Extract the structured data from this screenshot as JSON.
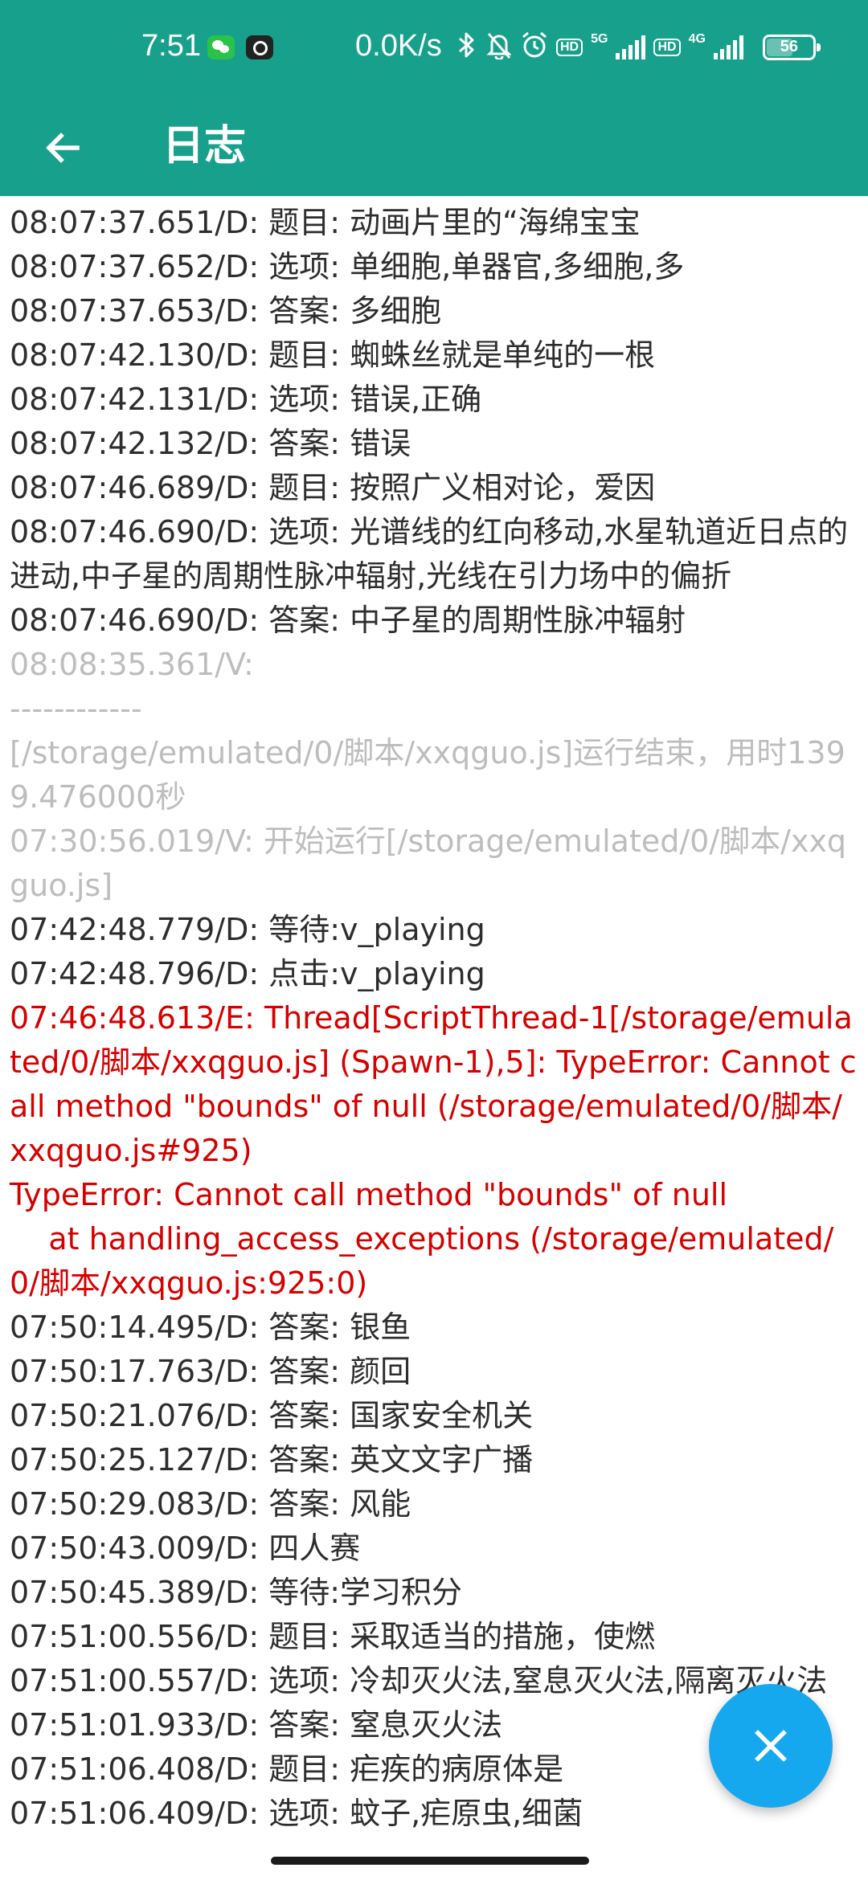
{
  "status_bar": {
    "time": "7:51",
    "net_speed": "0.0K/s",
    "network_1": "5G",
    "network_2": "4G",
    "hd_label": "HD",
    "battery": "56",
    "icons": [
      "wechat-icon",
      "app-notification-icon",
      "bluetooth-icon",
      "mute-bell-icon",
      "alarm-icon",
      "signal-icon",
      "battery-icon"
    ]
  },
  "app_bar": {
    "title": "日志",
    "back_icon": "arrow-left-icon"
  },
  "log_lines": [
    {
      "level": "D",
      "text": "08:07:37.651/D: 题目: 动画片里的“海绵宝宝"
    },
    {
      "level": "D",
      "text": "08:07:37.652/D: 选项: 单细胞,单器官,多细胞,多"
    },
    {
      "level": "D",
      "text": "08:07:37.653/D: 答案: 多细胞"
    },
    {
      "level": "D",
      "text": "08:07:42.130/D: 题目: 蜘蛛丝就是单纯的一根"
    },
    {
      "level": "D",
      "text": "08:07:42.131/D: 选项: 错误,正确"
    },
    {
      "level": "D",
      "text": "08:07:42.132/D: 答案: 错误"
    },
    {
      "level": "D",
      "text": "08:07:46.689/D: 题目: 按照广义相对论，爱因"
    },
    {
      "level": "D",
      "text": "08:07:46.690/D: 选项: 光谱线的红向移动,水星轨道近日点的进动,中子星的周期性脉冲辐射,光线在引力场中的偏折"
    },
    {
      "level": "D",
      "text": "08:07:46.690/D: 答案: 中子星的周期性脉冲辐射"
    },
    {
      "level": "V",
      "text": "08:08:35.361/V:\n------------\n[/storage/emulated/0/脚本/xxqguo.js]运行结束，用时1399.476000秒"
    },
    {
      "level": "V",
      "text": "07:30:56.019/V: 开始运行[/storage/emulated/0/脚本/xxqguo.js]"
    },
    {
      "level": "D",
      "text": "07:42:48.779/D: 等待:v_playing"
    },
    {
      "level": "D",
      "text": "07:42:48.796/D: 点击:v_playing"
    },
    {
      "level": "E",
      "text": "07:46:48.613/E: Thread[ScriptThread-1[/storage/emulated/0/脚本/xxqguo.js] (Spawn-1),5]: TypeError: Cannot call method \"bounds\" of null (/storage/emulated/0/脚本/xxqguo.js#925)\nTypeError: Cannot call method \"bounds\" of null\n    at handling_access_exceptions (/storage/emulated/0/脚本/xxqguo.js:925:0)\n"
    },
    {
      "level": "D",
      "text": "07:50:14.495/D: 答案: 银鱼"
    },
    {
      "level": "D",
      "text": "07:50:17.763/D: 答案: 颜回"
    },
    {
      "level": "D",
      "text": "07:50:21.076/D: 答案: 国家安全机关"
    },
    {
      "level": "D",
      "text": "07:50:25.127/D: 答案: 英文文字广播"
    },
    {
      "level": "D",
      "text": "07:50:29.083/D: 答案: 风能"
    },
    {
      "level": "D",
      "text": "07:50:43.009/D: 四人赛"
    },
    {
      "level": "D",
      "text": "07:50:45.389/D: 等待:学习积分"
    },
    {
      "level": "D",
      "text": "07:51:00.556/D: 题目: 采取适当的措施，使燃"
    },
    {
      "level": "D",
      "text": "07:51:00.557/D: 选项: 冷却灭火法,窒息灭火法,隔离灭火法"
    },
    {
      "level": "D",
      "text": "07:51:01.933/D: 答案: 窒息灭火法"
    },
    {
      "level": "D",
      "text": "07:51:06.408/D: 题目: 疟疾的病原体是"
    },
    {
      "level": "D",
      "text": "07:51:06.409/D: 选项: 蚊子,疟原虫,细菌"
    }
  ],
  "fab": {
    "icon": "close-icon",
    "color": "#16a8ee"
  },
  "colors": {
    "primary": "#17a08b",
    "log_debug": "#2d2d2d",
    "log_verbose": "#bdbdbd",
    "log_error": "#d50000"
  }
}
